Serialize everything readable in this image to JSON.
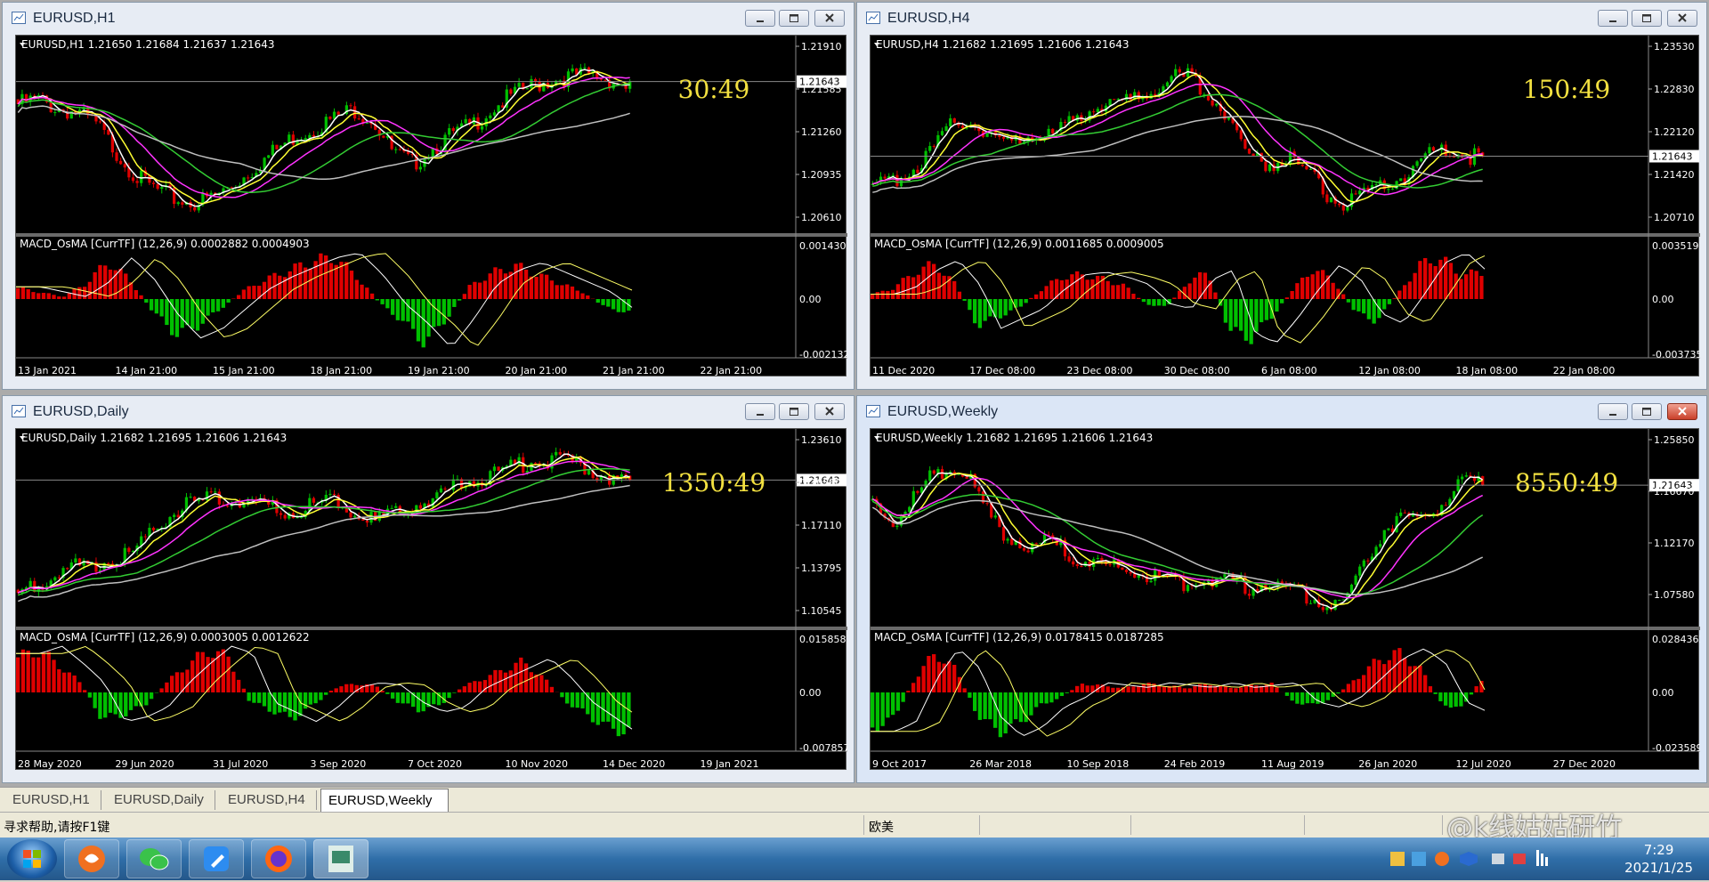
{
  "windows": [
    {
      "id": "h1",
      "title": "EURUSD,H1",
      "active": false,
      "header": "EURUSD,H1  1.21650 1.21684 1.21637 1.21643",
      "countdown": "30:49",
      "price_ticks": [
        "1.21910",
        "1.21585",
        "1.21260",
        "1.20935",
        "1.20610"
      ],
      "price_current": "1.21643",
      "macd_header": "MACD_OsMA [CurrTF] (12,26,9) 0.0002882 0.0004903",
      "macd_ticks": [
        "0.0014303",
        "0.00",
        "-0.0021327"
      ],
      "dates": [
        "13 Jan 2021",
        "14 Jan 21:00",
        "15 Jan 21:00",
        "18 Jan 21:00",
        "19 Jan 21:00",
        "20 Jan 21:00",
        "21 Jan 21:00",
        "22 Jan 21:00"
      ],
      "shape": [
        0.75,
        0.78,
        0.72,
        0.7,
        0.62,
        0.45,
        0.3,
        0.22,
        0.16,
        0.14,
        0.18,
        0.26,
        0.36,
        0.46,
        0.55,
        0.6,
        0.66,
        0.72,
        0.65,
        0.45,
        0.38,
        0.48,
        0.56,
        0.62,
        0.72,
        0.8,
        0.86,
        0.9,
        0.92,
        0.93,
        0.9,
        0.86
      ],
      "osma": [
        0.25,
        0.15,
        0.05,
        0.35,
        0.85,
        0.4,
        -0.3,
        -0.8,
        -0.6,
        -0.2,
        0.2,
        0.45,
        0.65,
        0.85,
        0.95,
        0.5,
        -0.1,
        -0.5,
        -1.0,
        -0.4,
        0.3,
        0.6,
        0.75,
        0.55,
        0.35,
        0.15,
        -0.2,
        -0.3
      ]
    },
    {
      "id": "h4",
      "title": "EURUSD,H4",
      "active": false,
      "header": "EURUSD,H4  1.21682 1.21695 1.21606 1.21643",
      "countdown": "150:49",
      "price_ticks": [
        "1.23530",
        "1.22830",
        "1.22120",
        "1.21420",
        "1.20710"
      ],
      "price_current": "1.21643",
      "macd_header": "MACD_OsMA [CurrTF] (12,26,9) 0.0011685 0.0009005",
      "macd_ticks": [
        "0.0035191",
        "0.00",
        "-0.003735"
      ],
      "dates": [
        "11 Dec 2020",
        "17 Dec 08:00",
        "23 Dec 08:00",
        "30 Dec 08:00",
        "6 Jan 08:00",
        "12 Jan 08:00",
        "18 Jan 08:00",
        "22 Jan 08:00"
      ],
      "shape": [
        0.22,
        0.28,
        0.35,
        0.45,
        0.62,
        0.66,
        0.55,
        0.5,
        0.58,
        0.55,
        0.62,
        0.72,
        0.78,
        0.76,
        0.84,
        0.9,
        0.92,
        0.82,
        0.7,
        0.45,
        0.38,
        0.42,
        0.35,
        0.2,
        0.12,
        0.18,
        0.25,
        0.3,
        0.42,
        0.48,
        0.44,
        0.42
      ],
      "osma": [
        0.1,
        0.25,
        0.6,
        0.8,
        0.3,
        -0.6,
        -0.4,
        -0.2,
        0.2,
        0.5,
        0.55,
        0.45,
        0.3,
        -0.1,
        -0.2,
        0.4,
        0.6,
        -0.7,
        -0.9,
        -0.4,
        0.2,
        0.7,
        0.4,
        -0.3,
        -0.5,
        0.1,
        0.75,
        0.95,
        0.55,
        0.6
      ]
    },
    {
      "id": "daily",
      "title": "EURUSD,Daily",
      "active": false,
      "header": "EURUSD,Daily  1.21682 1.21695 1.21606 1.21643",
      "countdown": "1350:49",
      "price_ticks": [
        "1.23610",
        "1.20360",
        "1.17110",
        "1.13795",
        "1.10545"
      ],
      "price_current": "1.21643",
      "macd_header": "MACD_OsMA [CurrTF] (12,26,9) 0.0003005 0.0012622",
      "macd_ticks": [
        "0.0158587",
        "0.00",
        "-0.0078573"
      ],
      "dates": [
        "28 May 2020",
        "29 Jun 2020",
        "31 Jul 2020",
        "3 Sep 2020",
        "7 Oct 2020",
        "10 Nov 2020",
        "14 Dec 2020",
        "19 Jan 2021"
      ],
      "shape": [
        0.15,
        0.22,
        0.28,
        0.32,
        0.35,
        0.36,
        0.42,
        0.55,
        0.68,
        0.72,
        0.74,
        0.74,
        0.7,
        0.68,
        0.66,
        0.7,
        0.72,
        0.68,
        0.6,
        0.65,
        0.7,
        0.74,
        0.8,
        0.86,
        0.9,
        0.94,
        0.97,
        0.98,
        0.96,
        0.92,
        0.88,
        0.85
      ],
      "osma": [
        0.8,
        0.95,
        0.6,
        0.2,
        -0.6,
        -0.5,
        -0.3,
        0.2,
        0.6,
        0.95,
        0.8,
        -0.2,
        -0.4,
        -0.6,
        -0.3,
        0.1,
        0.2,
        0.15,
        -0.2,
        -0.4,
        -0.3,
        0.1,
        0.3,
        0.5,
        0.7,
        0.3,
        -0.2,
        -0.5,
        -0.8,
        -0.9
      ]
    },
    {
      "id": "weekly",
      "title": "EURUSD,Weekly",
      "active": true,
      "header": "EURUSD,Weekly  1.21682 1.21695 1.21606 1.21643",
      "countdown": "8550:49",
      "price_ticks": [
        "1.25850",
        "1.16670",
        "1.12170",
        "1.07580"
      ],
      "price_current": "1.21643",
      "macd_header": "MACD_OsMA [CurrTF] (12,26,9) 0.0178415 0.0187285",
      "macd_ticks": [
        "0.0284362",
        "0.00",
        "-0.023589"
      ],
      "dates": [
        "9 Oct 2017",
        "26 Mar 2018",
        "10 Sep 2018",
        "24 Feb 2019",
        "11 Aug 2019",
        "26 Jan 2020",
        "12 Jul 2020",
        "27 Dec 2020"
      ],
      "shape": [
        0.7,
        0.6,
        0.72,
        0.88,
        0.93,
        0.85,
        0.62,
        0.5,
        0.45,
        0.48,
        0.4,
        0.35,
        0.32,
        0.3,
        0.28,
        0.25,
        0.22,
        0.26,
        0.24,
        0.2,
        0.22,
        0.18,
        0.15,
        0.1,
        0.12,
        0.35,
        0.55,
        0.62,
        0.6,
        0.72,
        0.85,
        0.82
      ],
      "osma": [
        -0.8,
        -0.6,
        0.3,
        0.9,
        0.5,
        -0.5,
        -0.9,
        -0.7,
        -0.3,
        -0.1,
        0.2,
        0.15,
        0.1,
        0.2,
        0.15,
        0.1,
        0.2,
        0.1,
        0.15,
        0.2,
        -0.2,
        -0.3,
        -0.1,
        0.3,
        0.7,
        0.9,
        0.6,
        -0.2,
        -0.4,
        0.3
      ]
    }
  ],
  "tabs": [
    "EURUSD,H1",
    "EURUSD,Daily",
    "EURUSD,H4",
    "EURUSD,Weekly"
  ],
  "active_tab": "EURUSD,Weekly",
  "status": {
    "help": "寻求帮助,请按F1键",
    "profile": "欧美"
  },
  "clock": {
    "time": "7:29",
    "date": "2021/1/25"
  },
  "watermark": "@k线姑姑研竹",
  "colors": {
    "bull": "#00c000",
    "bear": "#e00000",
    "ma_fast": "#ffffff",
    "ma_mid": "#ffff33",
    "ma_magenta": "#ff33ff",
    "ma_green": "#33cc33",
    "ma_gray": "#bfbfbf",
    "countdown": "#f2e040"
  }
}
